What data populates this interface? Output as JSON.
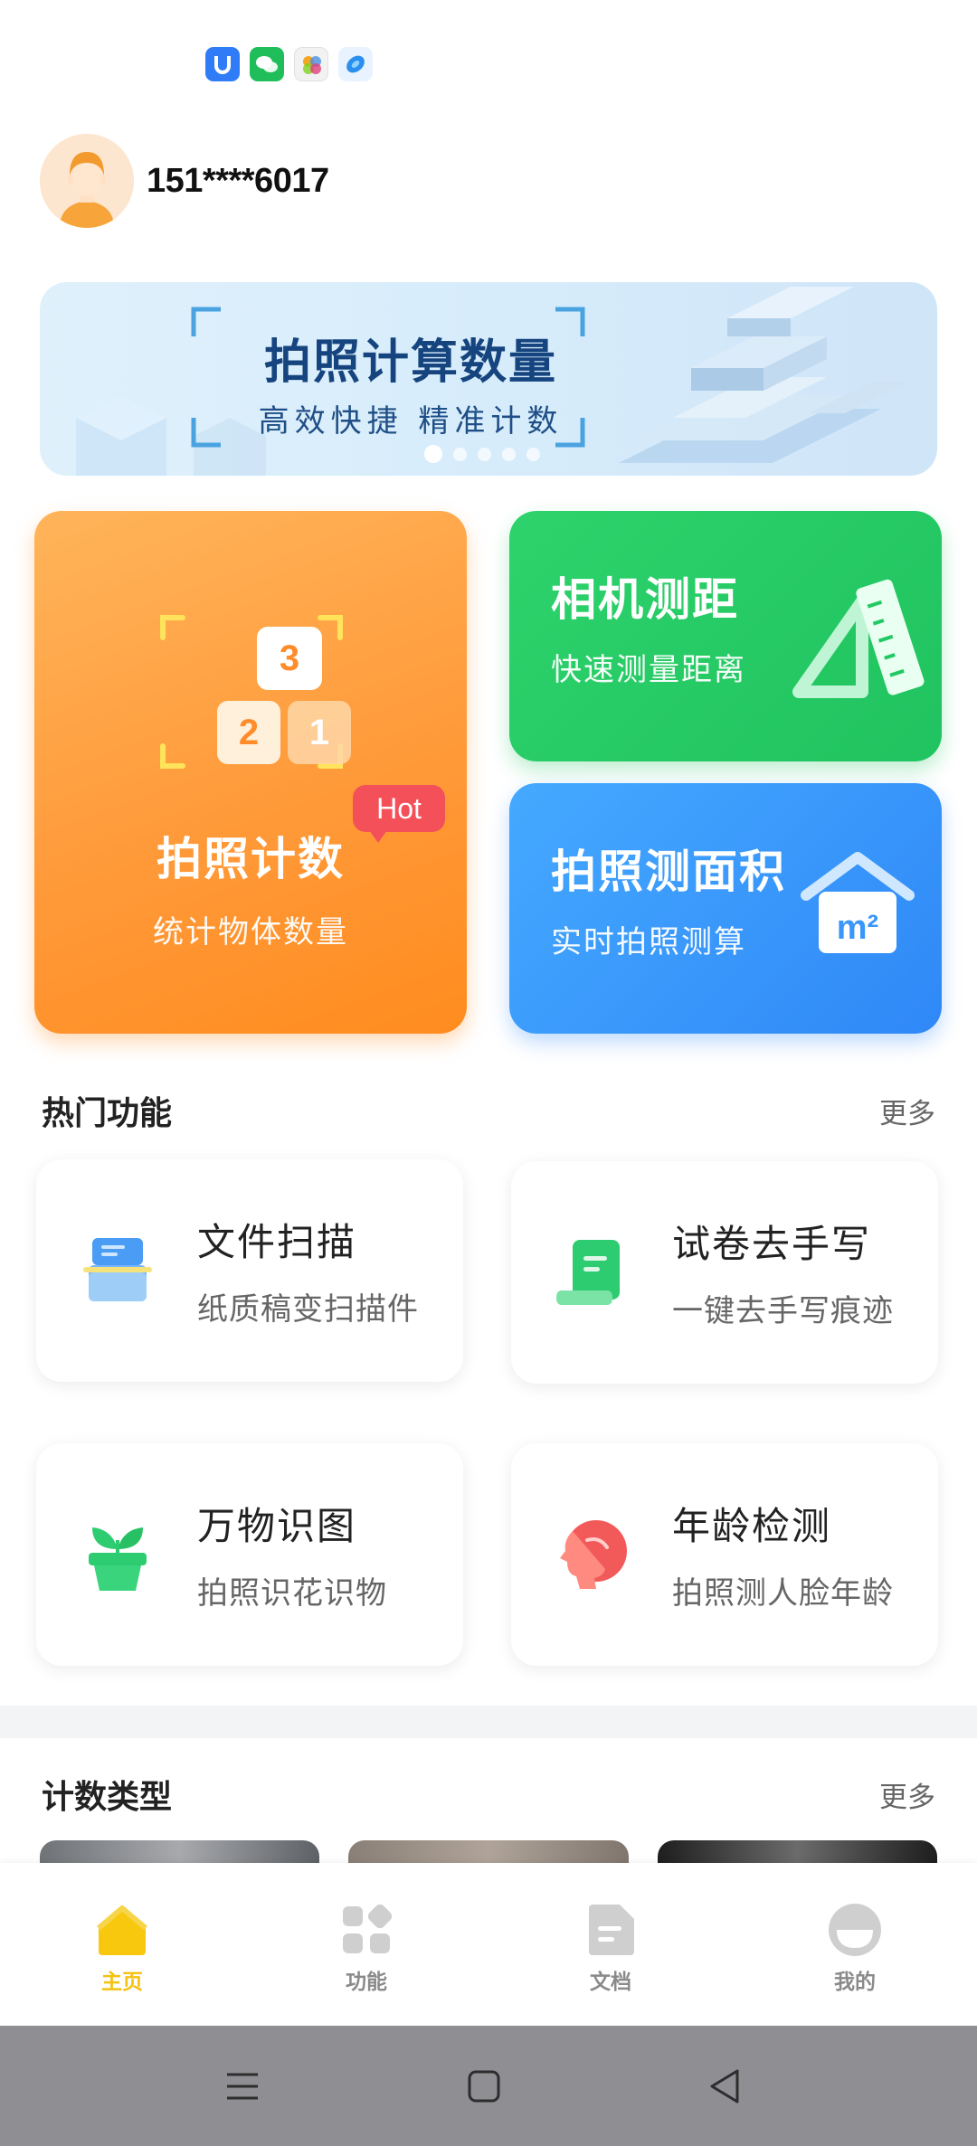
{
  "status_bar": {
    "icons": [
      "shield-app-icon",
      "wechat-icon",
      "photos-app-icon",
      "browser-icon"
    ]
  },
  "user": {
    "phone": "151****6017"
  },
  "banner": {
    "title": "拍照计算数量",
    "subtitle": "高效快捷 精准计数",
    "slides": 5,
    "active_slide": 1
  },
  "cards": {
    "count": {
      "title": "拍照计数",
      "subtitle": "统计物体数量",
      "badge": "Hot",
      "digits": [
        "3",
        "2",
        "1"
      ]
    },
    "range": {
      "title": "相机测距",
      "subtitle": "快速测量距离"
    },
    "area": {
      "title": "拍照测面积",
      "subtitle": "实时拍照测算",
      "icon_text": "m²"
    }
  },
  "hot_section": {
    "title": "热门功能",
    "more": "更多",
    "items": [
      {
        "name": "文件扫描",
        "desc": "纸质稿变扫描件",
        "icon": "document-scan-icon"
      },
      {
        "name": "试卷去手写",
        "desc": "一键去手写痕迹",
        "icon": "test-paper-icon"
      },
      {
        "name": "万物识图",
        "desc": "拍照识花识物",
        "icon": "plant-pot-icon"
      },
      {
        "name": "年龄检测",
        "desc": "拍照测人脸年龄",
        "icon": "face-profile-icon"
      }
    ]
  },
  "count_types": {
    "title": "计数类型",
    "more": "更多"
  },
  "bottom_nav": {
    "items": [
      {
        "label": "主页",
        "icon": "home-icon",
        "active": true
      },
      {
        "label": "功能",
        "icon": "grid-icon",
        "active": false
      },
      {
        "label": "文档",
        "icon": "document-icon",
        "active": false
      },
      {
        "label": "我的",
        "icon": "profile-icon",
        "active": false
      }
    ]
  },
  "colors": {
    "accent_yellow": "#f5c211",
    "orange_card": "#ff9a3a",
    "green_card": "#22c862",
    "blue_card": "#3a96fb",
    "hot_badge": "#f3505a"
  }
}
